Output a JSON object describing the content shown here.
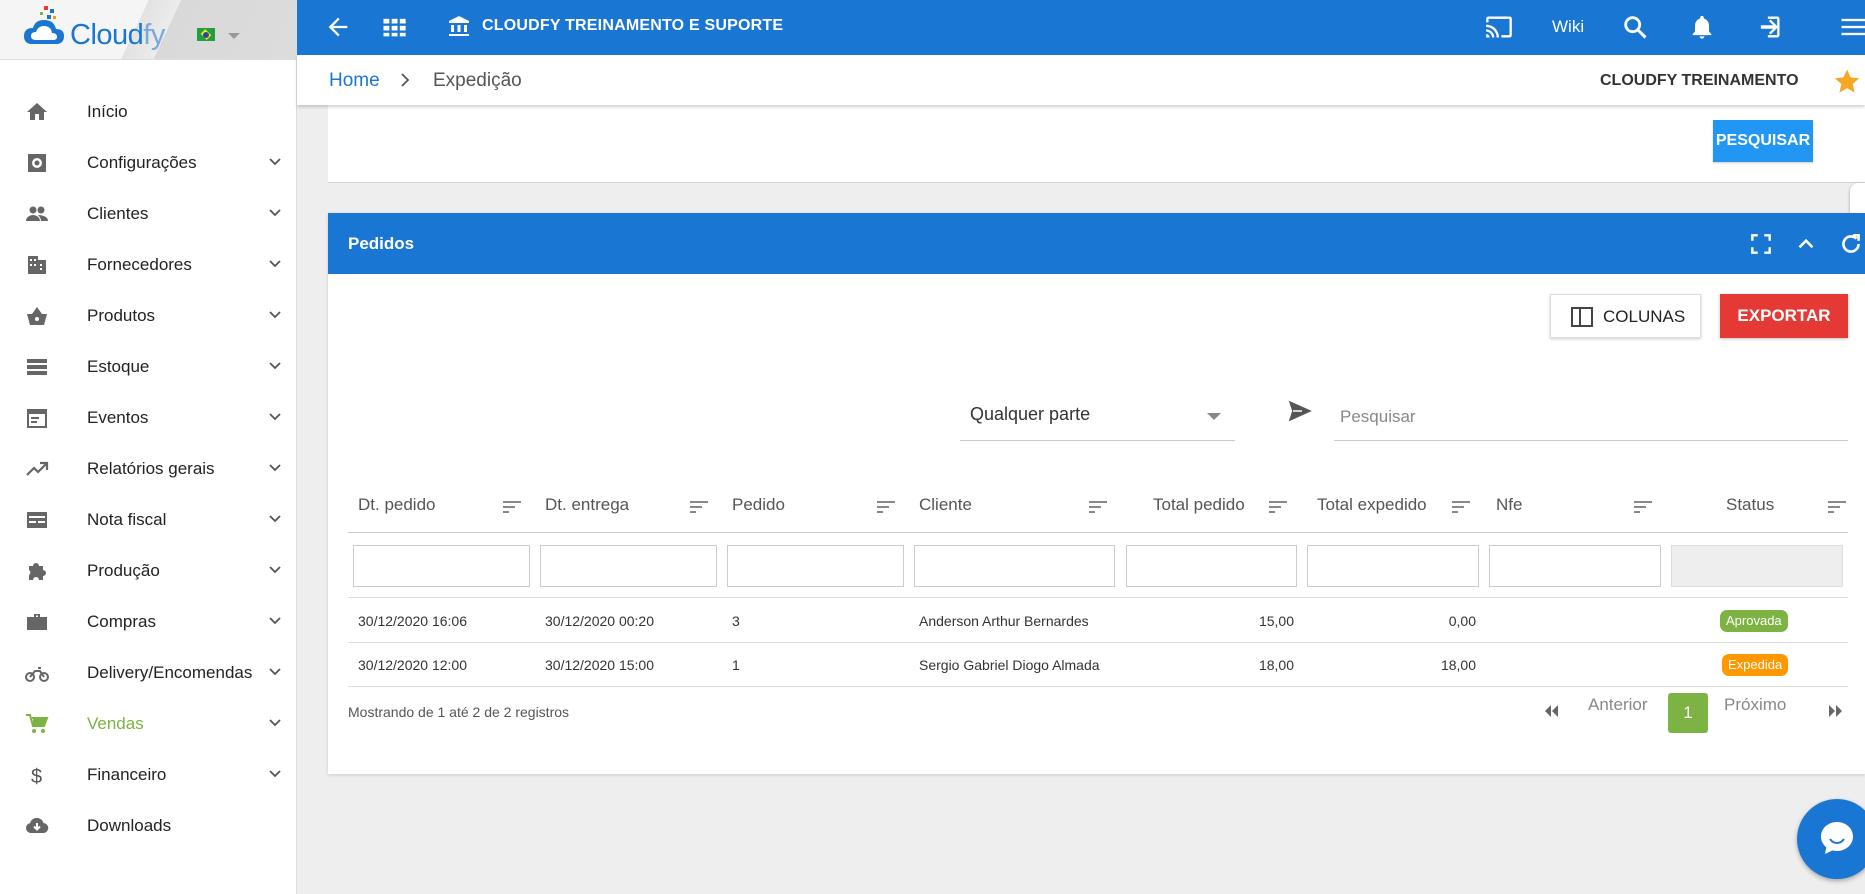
{
  "app": {
    "logo_text_main": "Cloud",
    "logo_text_end": "fy",
    "language_flag": "brazil-flag"
  },
  "sidebar": {
    "items": [
      {
        "label": "Início",
        "icon": "home-icon",
        "expandable": false
      },
      {
        "label": "Configurações",
        "icon": "settings-icon",
        "expandable": true
      },
      {
        "label": "Clientes",
        "icon": "people-icon",
        "expandable": true
      },
      {
        "label": "Fornecedores",
        "icon": "building-icon",
        "expandable": true
      },
      {
        "label": "Produtos",
        "icon": "basket-icon",
        "expandable": true
      },
      {
        "label": "Estoque",
        "icon": "storage-icon",
        "expandable": true
      },
      {
        "label": "Eventos",
        "icon": "calendar-icon",
        "expandable": true
      },
      {
        "label": "Relatórios gerais",
        "icon": "trending-up-icon",
        "expandable": true
      },
      {
        "label": "Nota fiscal",
        "icon": "card-icon",
        "expandable": true
      },
      {
        "label": "Produção",
        "icon": "puzzle-icon",
        "expandable": true
      },
      {
        "label": "Compras",
        "icon": "briefcase-icon",
        "expandable": true
      },
      {
        "label": "Delivery/Encomendas",
        "icon": "motorcycle-icon",
        "expandable": true
      },
      {
        "label": "Vendas",
        "icon": "cart-icon",
        "expandable": true,
        "active": true
      },
      {
        "label": "Financeiro",
        "icon": "dollar-icon",
        "expandable": true
      },
      {
        "label": "Downloads",
        "icon": "cloud-download-icon",
        "expandable": false
      }
    ],
    "active_color": "#7cb342"
  },
  "topbar": {
    "title": "CLOUDFY TREINAMENTO E SUPORTE",
    "wiki_label": "Wiki",
    "bg_color": "#1976d2"
  },
  "breadcrumb": {
    "home": "Home",
    "current": "Expedição",
    "company": "CLOUDFY TREINAMENTO"
  },
  "search_card": {
    "button_label": "PESQUISAR"
  },
  "pedidos": {
    "title": "Pedidos",
    "columns_button": "COLUNAS",
    "export_button": "EXPORTAR",
    "scope_select_value": "Qualquer parte",
    "search_placeholder": "Pesquisar",
    "columns": [
      "Dt. pedido",
      "Dt. entrega",
      "Pedido",
      "Cliente",
      "Total pedido",
      "Total expedido",
      "Nfe",
      "Status"
    ],
    "rows": [
      {
        "dt_pedido": "30/12/2020 16:06",
        "dt_entrega": "30/12/2020 00:20",
        "pedido": "3",
        "cliente": "Anderson Arthur Bernardes",
        "total_pedido": "15,00",
        "total_expedido": "0,00",
        "nfe": "",
        "status": "Aprovada",
        "status_color": "#7cb342"
      },
      {
        "dt_pedido": "30/12/2020 12:00",
        "dt_entrega": "30/12/2020 15:00",
        "pedido": "1",
        "cliente": "Sergio Gabriel Diogo Almada",
        "total_pedido": "18,00",
        "total_expedido": "18,00",
        "nfe": "",
        "status": "Expedida",
        "status_color": "#ff9800"
      }
    ],
    "footer_info": "Mostrando de 1 até 2 de 2 registros",
    "pagination": {
      "previous": "Anterior",
      "next": "Próximo",
      "current_page": "1"
    }
  }
}
